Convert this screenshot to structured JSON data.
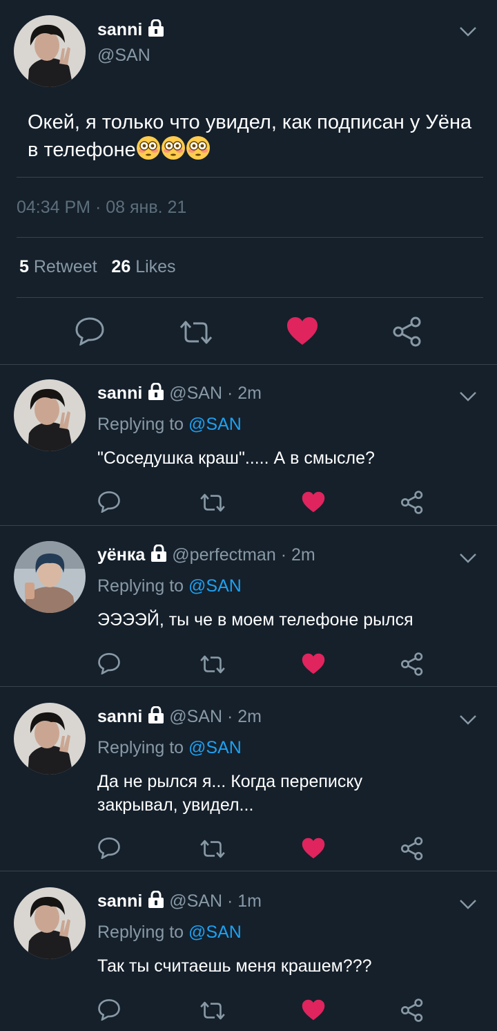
{
  "main_tweet": {
    "author_name": "sanni",
    "author_handle": "@SAN",
    "text": "Окей, я только что увидел, как подписан у Уёна в телефоне",
    "timestamp": "04:34 PM · 08 янв. 21",
    "retweet_count": "5",
    "retweet_label": "Retweet",
    "like_count": "26",
    "like_label": "Likes"
  },
  "replies": [
    {
      "name": "sanni",
      "handle": "@SAN",
      "time": "· 2m",
      "replying_label": "Replying to",
      "replying_to": "@SAN",
      "text": "\"Соседушка краш\"..... А в смысле?"
    },
    {
      "name": "уёнка",
      "handle": "@perfectman",
      "time": "· 2m",
      "replying_label": "Replying to",
      "replying_to": "@SAN",
      "text": "ЭЭЭЭЙ, ты че в моем телефоне рылся"
    },
    {
      "name": "sanni",
      "handle": "@SAN",
      "time": "· 2m",
      "replying_label": "Replying to",
      "replying_to": "@SAN",
      "text": "Да не рылся я... Когда переписку закрывал, увидел..."
    },
    {
      "name": "sanni",
      "handle": "@SAN",
      "time": "· 1m",
      "replying_label": "Replying to",
      "replying_to": "@SAN",
      "text": "Так ты считаешь меня крашем???"
    }
  ],
  "colors": {
    "background": "#15202b",
    "secondary_text": "#8899a6",
    "link": "#1da1f2",
    "like": "#e0245e",
    "divider": "#38444d"
  },
  "icons": [
    "lock-icon",
    "chevron-down-icon",
    "reply-icon",
    "retweet-icon",
    "heart-icon",
    "share-icon",
    "flushed-face-emoji"
  ]
}
